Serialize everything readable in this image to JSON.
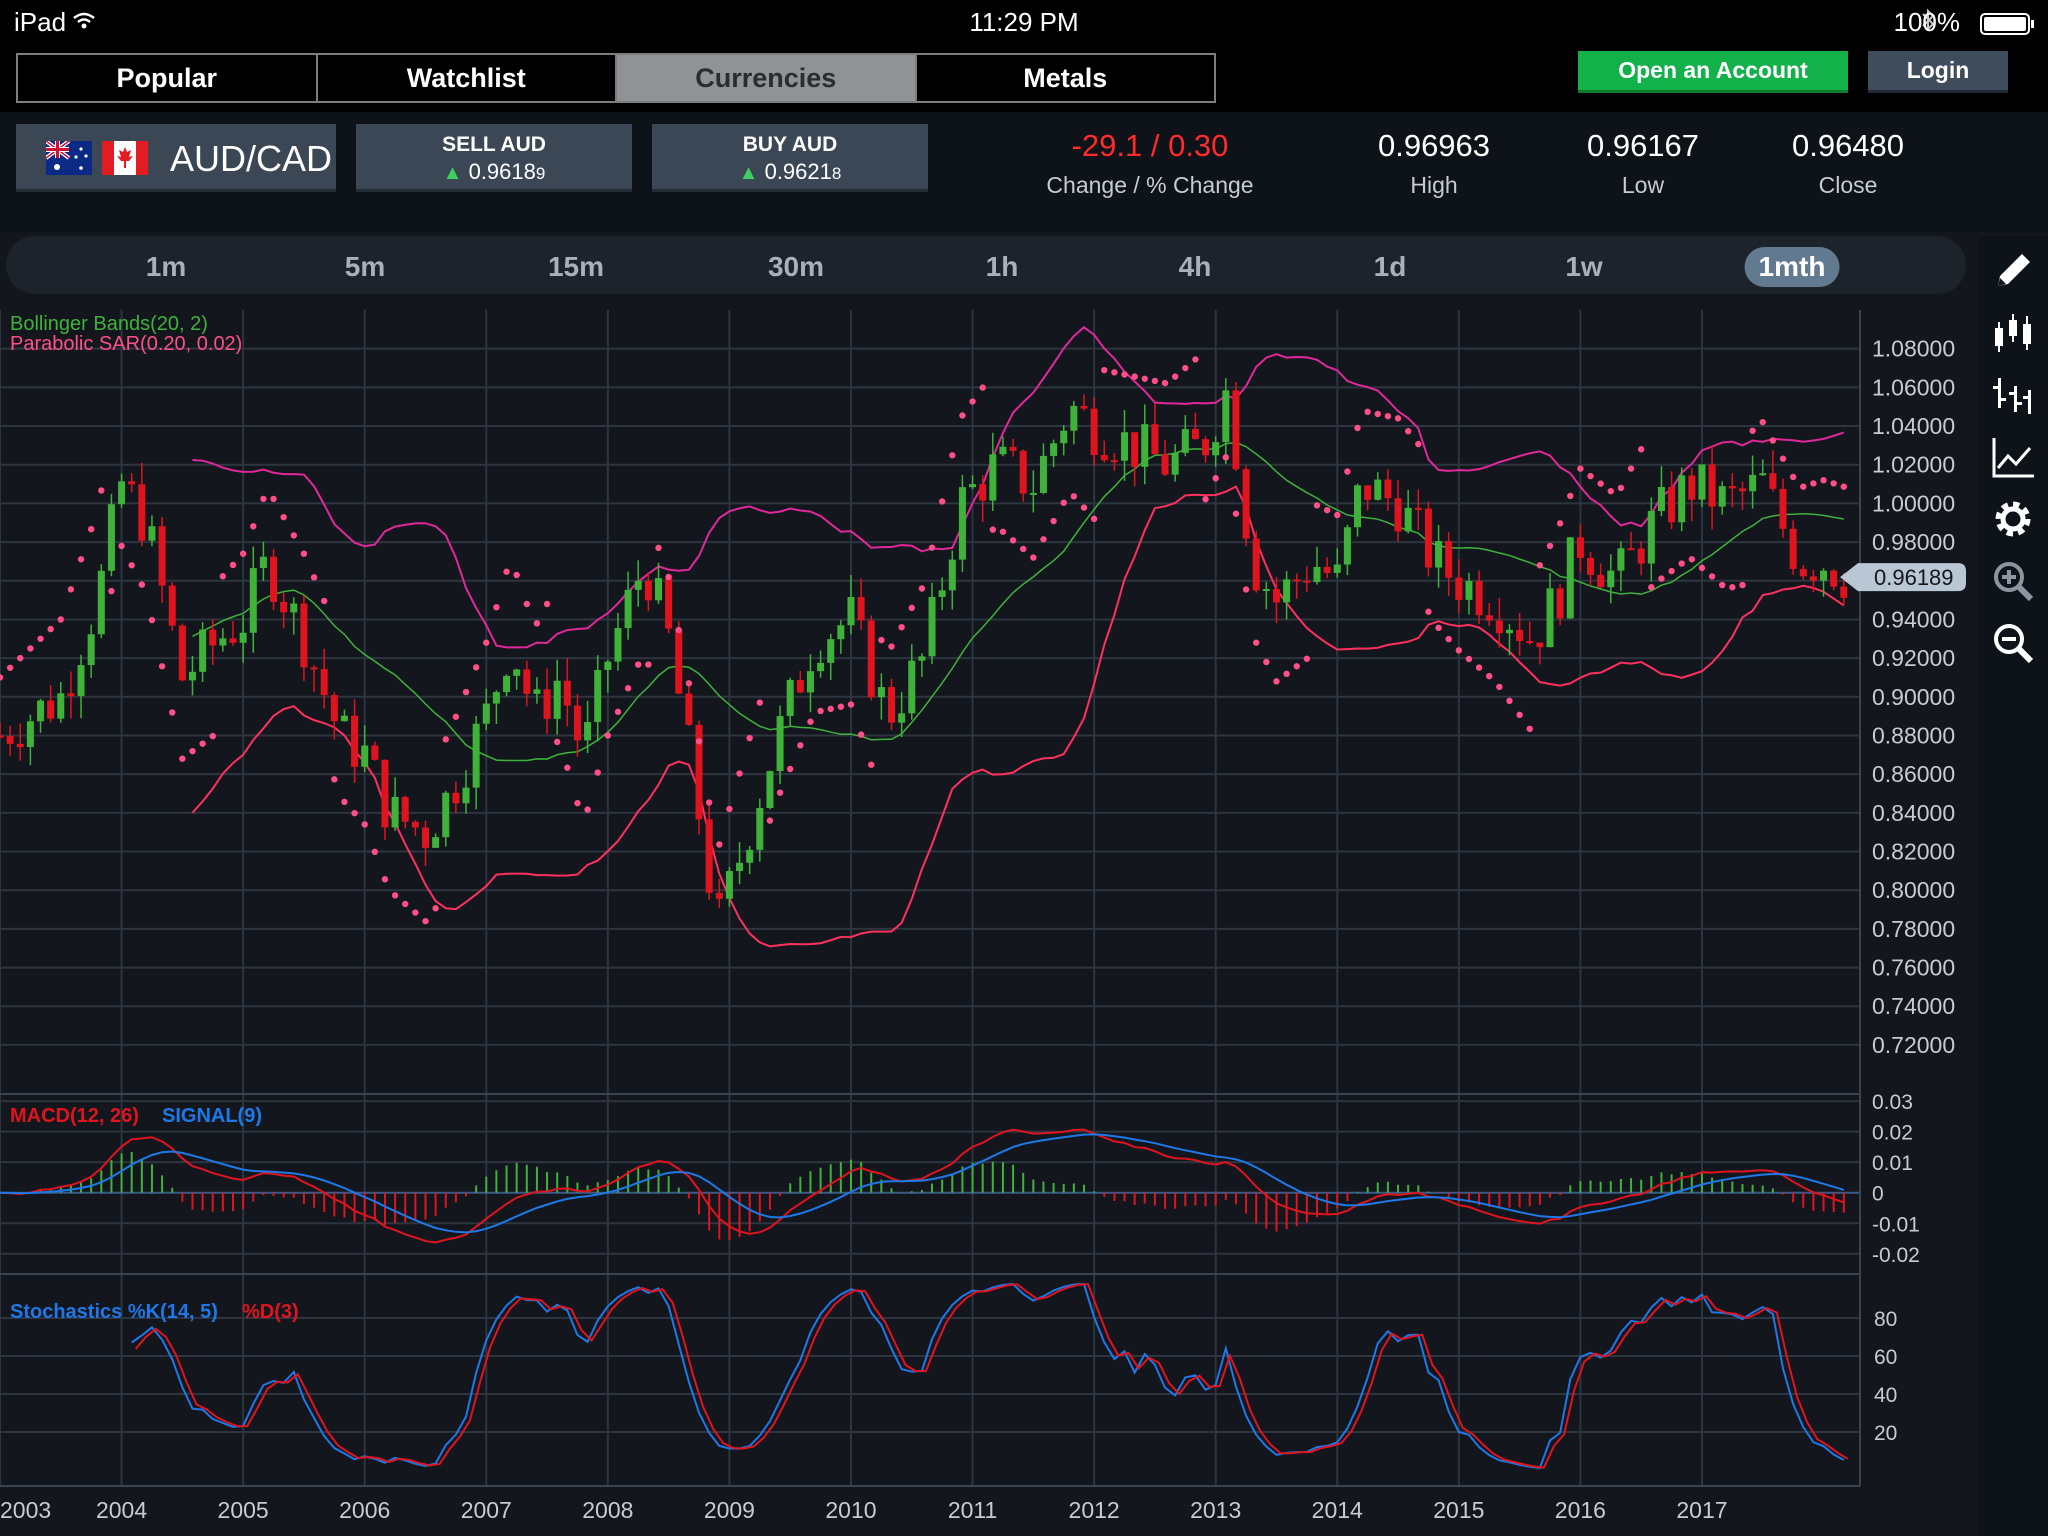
{
  "status_bar": {
    "device": "iPad",
    "time": "11:29 PM",
    "battery": "100%"
  },
  "tabs": [
    {
      "label": "Popular",
      "active": false
    },
    {
      "label": "Watchlist",
      "active": false
    },
    {
      "label": "Currencies",
      "active": true
    },
    {
      "label": "Metals",
      "active": false
    }
  ],
  "header_buttons": {
    "open_account": "Open an Account",
    "login": "Login"
  },
  "instrument": {
    "pair": "AUD/CAD",
    "sell": {
      "label": "SELL AUD",
      "price_main": "0.9618",
      "price_pip": "9"
    },
    "buy": {
      "label": "BUY AUD",
      "price_main": "0.9621",
      "price_pip": "8"
    },
    "change": {
      "value": "-29.1 / 0.30",
      "label": "Change / % Change",
      "color": "#ff2a2a"
    },
    "high": {
      "value": "0.96963",
      "label": "High"
    },
    "low": {
      "value": "0.96167",
      "label": "Low"
    },
    "close": {
      "value": "0.96480",
      "label": "Close"
    }
  },
  "timeframes": [
    {
      "label": "1m",
      "active": false
    },
    {
      "label": "5m",
      "active": false
    },
    {
      "label": "15m",
      "active": false
    },
    {
      "label": "30m",
      "active": false
    },
    {
      "label": "1h",
      "active": false
    },
    {
      "label": "4h",
      "active": false
    },
    {
      "label": "1d",
      "active": false
    },
    {
      "label": "1w",
      "active": false
    },
    {
      "label": "1mth",
      "active": true
    }
  ],
  "tools": [
    "pencil-icon",
    "candlestick-icon",
    "ohlc-bars-icon",
    "line-chart-icon",
    "gear-icon",
    "zoom-in-icon",
    "zoom-out-icon"
  ],
  "chart_data": {
    "type": "candlestick",
    "x_labels": [
      "2003",
      "2004",
      "2005",
      "2006",
      "2007",
      "2008",
      "2009",
      "2010",
      "2011",
      "2012",
      "2013",
      "2014",
      "2015",
      "2016",
      "2017"
    ],
    "x_range": [
      2003.0,
      2018.3
    ],
    "price_panel": {
      "legend": [
        "Bollinger Bands(20, 2)",
        "Parabolic SAR(0.20, 0.02)"
      ],
      "legend_colors": [
        "#3fb23a",
        "#ff4f86"
      ],
      "y_ticks": [
        "1.08000",
        "1.06000",
        "1.04000",
        "1.02000",
        "1.00000",
        "0.98000",
        "0.96000",
        "0.94000",
        "0.92000",
        "0.90000",
        "0.88000",
        "0.86000",
        "0.84000",
        "0.82000",
        "0.80000",
        "0.78000",
        "0.76000",
        "0.74000",
        "0.72000"
      ],
      "y_range": [
        0.706,
        1.1
      ],
      "current_price": "0.96189",
      "close_series": [
        [
          2003.0,
          0.88
        ],
        [
          2003.5,
          0.9
        ],
        [
          2003.8,
          0.95
        ],
        [
          2004.0,
          1.01
        ],
        [
          2004.2,
          0.99
        ],
        [
          2004.5,
          0.91
        ],
        [
          2004.8,
          0.93
        ],
        [
          2005.0,
          0.94
        ],
        [
          2005.2,
          0.97
        ],
        [
          2005.5,
          0.93
        ],
        [
          2005.8,
          0.88
        ],
        [
          2006.0,
          0.87
        ],
        [
          2006.2,
          0.84
        ],
        [
          2006.5,
          0.83
        ],
        [
          2006.7,
          0.85
        ],
        [
          2007.0,
          0.89
        ],
        [
          2007.2,
          0.93
        ],
        [
          2007.4,
          0.89
        ],
        [
          2007.6,
          0.91
        ],
        [
          2007.8,
          0.87
        ],
        [
          2008.0,
          0.92
        ],
        [
          2008.3,
          0.97
        ],
        [
          2008.5,
          0.93
        ],
        [
          2008.7,
          0.86
        ],
        [
          2008.9,
          0.78
        ],
        [
          2009.1,
          0.82
        ],
        [
          2009.4,
          0.88
        ],
        [
          2009.7,
          0.93
        ],
        [
          2010.0,
          0.94
        ],
        [
          2010.3,
          0.89
        ],
        [
          2010.6,
          0.92
        ],
        [
          2010.9,
          1.0
        ],
        [
          2011.2,
          1.02
        ],
        [
          2011.5,
          1.01
        ],
        [
          2011.8,
          1.05
        ],
        [
          2012.0,
          1.04
        ],
        [
          2012.3,
          1.03
        ],
        [
          2012.6,
          1.02
        ],
        [
          2012.9,
          1.03
        ],
        [
          2013.1,
          1.06
        ],
        [
          2013.3,
          0.97
        ],
        [
          2013.5,
          0.95
        ],
        [
          2013.8,
          0.97
        ],
        [
          2014.0,
          0.96
        ],
        [
          2014.2,
          1.01
        ],
        [
          2014.5,
          1.0
        ],
        [
          2014.8,
          0.97
        ],
        [
          2015.0,
          0.96
        ],
        [
          2015.3,
          0.95
        ],
        [
          2015.6,
          0.93
        ],
        [
          2015.8,
          0.95
        ],
        [
          2016.0,
          0.98
        ],
        [
          2016.3,
          0.96
        ],
        [
          2016.6,
          0.99
        ],
        [
          2016.9,
          1.01
        ],
        [
          2017.2,
          1.0
        ],
        [
          2017.5,
          1.01
        ],
        [
          2017.8,
          0.97
        ],
        [
          2018.0,
          0.97
        ],
        [
          2018.2,
          0.962
        ]
      ]
    },
    "macd_panel": {
      "legend": [
        "MACD(12, 26)",
        "SIGNAL(9)"
      ],
      "legend_colors": [
        "#e0141e",
        "#1e78e8"
      ],
      "y_ticks": [
        "0.03",
        "0.02",
        "0.01",
        "0",
        "-0.01",
        "-0.02"
      ],
      "y_range": [
        -0.024,
        0.032
      ]
    },
    "stoch_panel": {
      "legend": [
        "Stochastics %K(14, 5)",
        "%D(3)"
      ],
      "legend_colors": [
        "#1e78e8",
        "#e0141e"
      ],
      "y_ticks": [
        "80",
        "60",
        "40",
        "20"
      ],
      "y_range": [
        0,
        100
      ]
    }
  }
}
